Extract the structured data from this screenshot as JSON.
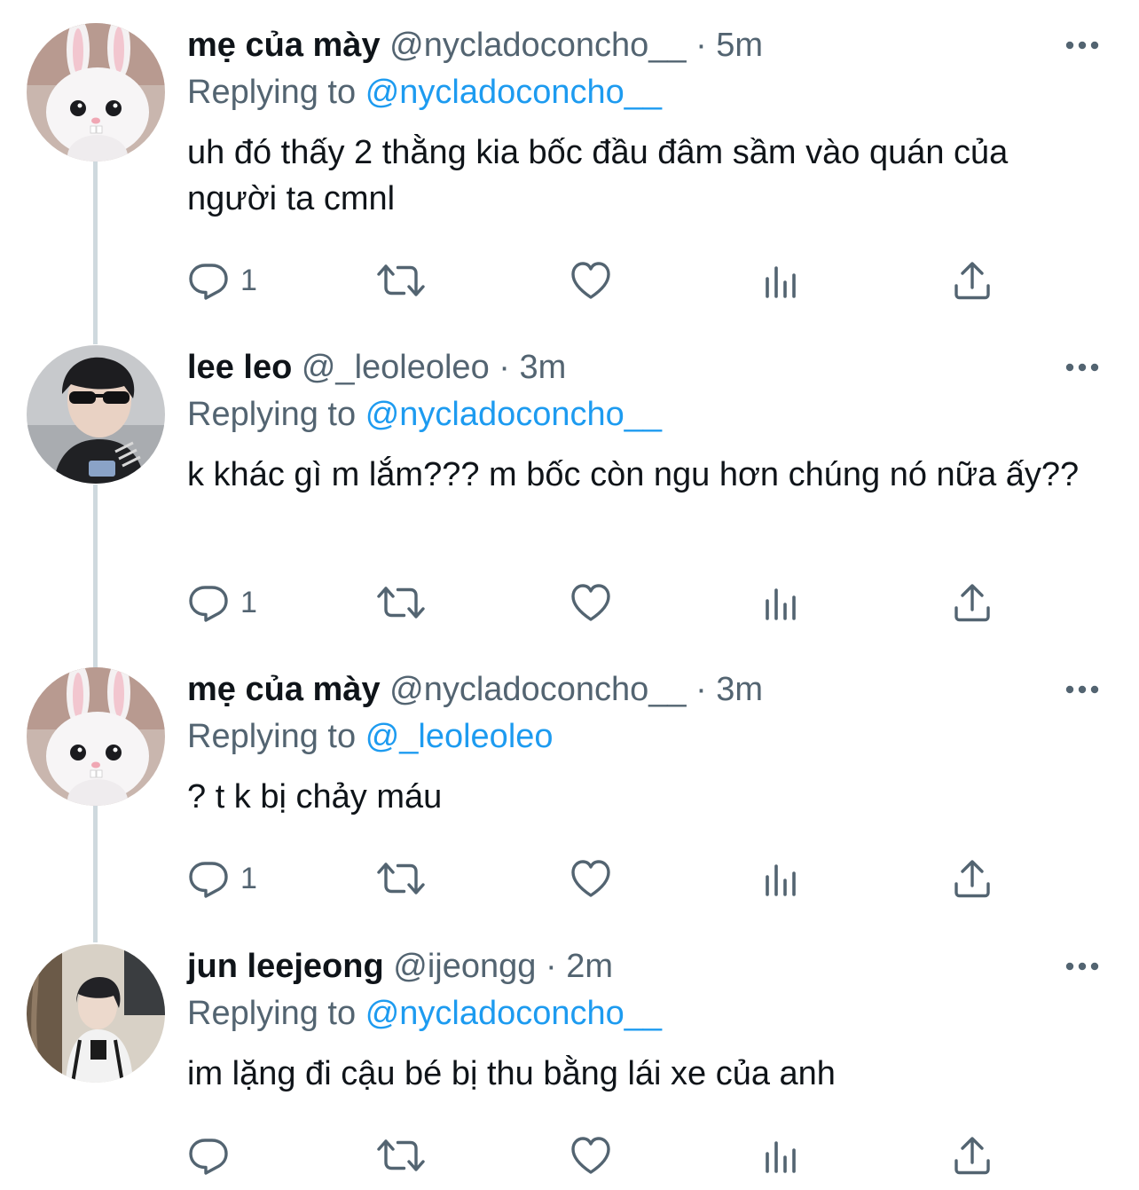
{
  "colors": {
    "link": "#1d9bf0",
    "secondary": "#536471",
    "text": "#0f1419",
    "thread_line": "#cfd9de"
  },
  "replying_prefix": "Replying to",
  "tweets": [
    {
      "name": "mẹ của mày",
      "handle": "@nycladoconcho__",
      "separator": "·",
      "time": "5m",
      "replying_to": "@nycladoconcho__",
      "text": "uh đó thấy 2 thằng kia bốc đầu đâm sầm vào quán của người ta cmnl",
      "reply_count": "1",
      "avatar": "bunny-avatar"
    },
    {
      "name": "lee leo",
      "handle": "@_leoleoleo",
      "separator": "·",
      "time": "3m",
      "replying_to": "@nycladoconcho__",
      "text": "k khác gì m lắm??? m bốc còn ngu hơn chúng nó nữa ấy??",
      "reply_count": "1",
      "avatar": "person-sunglasses-avatar"
    },
    {
      "name": "mẹ của mày",
      "handle": "@nycladoconcho__",
      "separator": "·",
      "time": "3m",
      "replying_to": "@_leoleoleo",
      "text": "? t k bị chảy máu",
      "reply_count": "1",
      "avatar": "bunny-avatar"
    },
    {
      "name": "jun leejeong",
      "handle": "@ijeongg",
      "separator": "·",
      "time": "2m",
      "replying_to": "@nycladoconcho__",
      "text": "im lặng đi cậu bé bị thu bằng lái xe của anh",
      "reply_count": "",
      "avatar": "person-room-avatar"
    }
  ],
  "icons": {
    "more": "more-icon",
    "reply": "reply-icon",
    "retweet": "retweet-icon",
    "like": "like-icon",
    "views": "views-icon",
    "share": "share-icon"
  }
}
